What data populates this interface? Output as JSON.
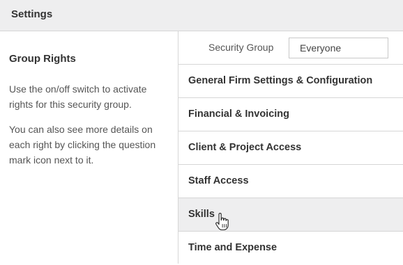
{
  "header": {
    "title": "Settings"
  },
  "left": {
    "title": "Group Rights",
    "paragraph1": "Use the on/off switch to activate rights for this security group.",
    "paragraph2": "You can also see more details on each right by clicking the question mark icon next to it."
  },
  "security_group": {
    "label": "Security Group",
    "value": "Everyone"
  },
  "categories": [
    {
      "label": "General Firm Settings & Configuration"
    },
    {
      "label": "Financial & Invoicing"
    },
    {
      "label": "Client & Project Access"
    },
    {
      "label": "Staff Access"
    },
    {
      "label": "Skills"
    },
    {
      "label": "Time and Expense"
    }
  ],
  "cursor": {
    "icon": "hand-pointer-icon"
  }
}
